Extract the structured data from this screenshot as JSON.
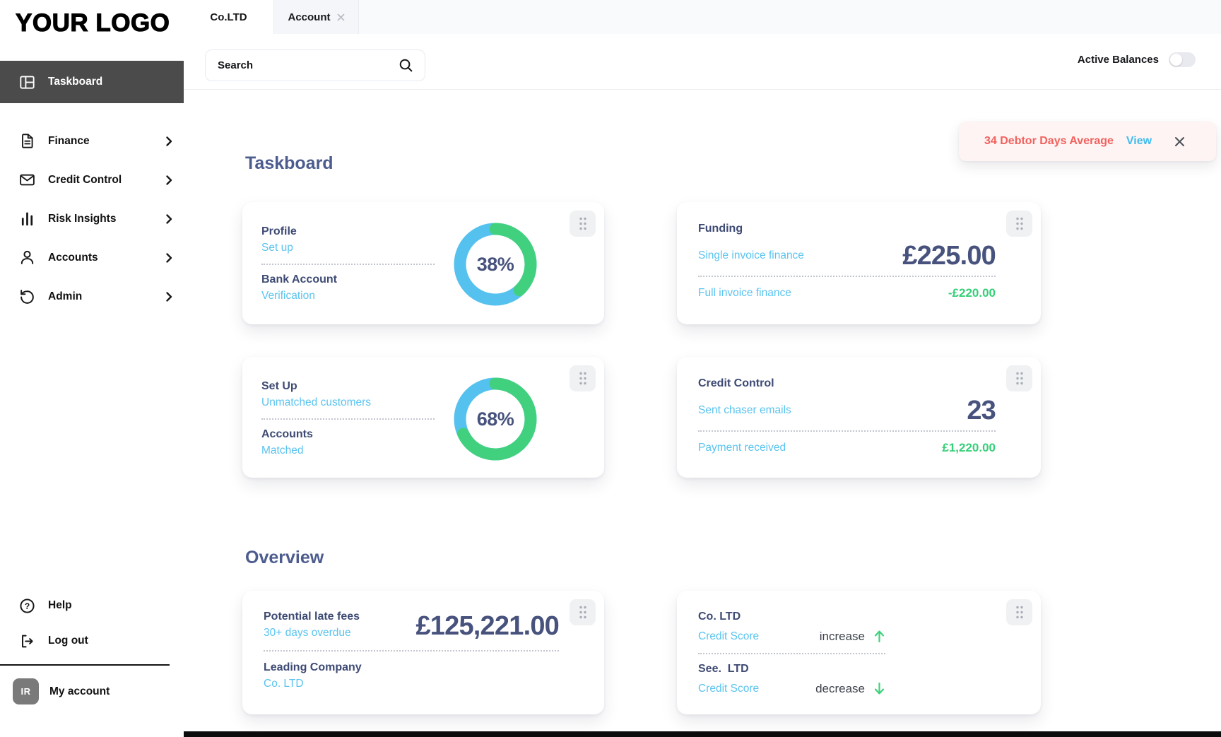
{
  "app": {
    "logo_text": "YOUR LOGO"
  },
  "tabs": [
    {
      "label": "Co.LTD"
    },
    {
      "label": "Account"
    }
  ],
  "search": {
    "placeholder": "Search"
  },
  "topbar": {
    "active_balances_label": "Active Balances",
    "active_balances_state": "off"
  },
  "notification": {
    "message": "34 Debtor Days Average",
    "action_label": "View"
  },
  "sidebar": {
    "active": {
      "label": "Taskboard"
    },
    "items": [
      {
        "label": "Finance"
      },
      {
        "label": "Credit Control"
      },
      {
        "label": "Risk Insights"
      },
      {
        "label": "Accounts"
      },
      {
        "label": "Admin"
      }
    ],
    "footer": [
      {
        "label": "Help"
      },
      {
        "label": "Log out"
      }
    ],
    "account": {
      "initials": "IR",
      "label": "My account"
    }
  },
  "main": {
    "sections": [
      {
        "title": "Taskboard",
        "cards": [
          {
            "type": "donut",
            "percent": 38,
            "percent_label": "38%",
            "entries": [
              {
                "title": "Profile",
                "subtitle": "Set up"
              },
              {
                "title": "Bank Account",
                "subtitle": "Verification"
              }
            ]
          },
          {
            "type": "stats",
            "title": "Funding",
            "primary": {
              "label": "Single invoice finance",
              "value": "£225.00"
            },
            "secondary": {
              "label": "Full invoice finance",
              "value": "-£220.00"
            }
          },
          {
            "type": "donut",
            "percent": 68,
            "percent_label": "68%",
            "entries": [
              {
                "title": "Set Up",
                "subtitle": "Unmatched customers"
              },
              {
                "title": "Accounts",
                "subtitle": "Matched"
              }
            ]
          },
          {
            "type": "stats",
            "title": "Credit Control",
            "primary": {
              "label": "Sent chaser emails",
              "value": "23"
            },
            "secondary": {
              "label": "Payment received",
              "value": "£1,220.00"
            }
          }
        ]
      },
      {
        "title": "Overview",
        "cards": [
          {
            "type": "overview",
            "primary": {
              "title": "Potential late fees",
              "subtitle": "30+ days overdue",
              "value": "£125,221.00"
            },
            "secondary": {
              "title": "Leading Company",
              "subtitle": "Co. LTD"
            }
          },
          {
            "type": "trend",
            "entries": [
              {
                "title": "Co. LTD",
                "label": "Credit Score",
                "trend": "increase",
                "direction": "up"
              },
              {
                "title": "See.  LTD",
                "label": "Credit Score",
                "trend": "decrease",
                "direction": "down"
              }
            ]
          }
        ]
      }
    ]
  },
  "colors": {
    "donut_blue": "#55c1ee",
    "donut_green": "#41d17e",
    "navy_text": "#47527d",
    "light_blue_text": "#5ac3ef",
    "positive_green_text": "#34d077",
    "alert_red": "#f2615d",
    "link_blue": "#41bbf0",
    "active_sidebar_bg": "#4b4b4b"
  }
}
